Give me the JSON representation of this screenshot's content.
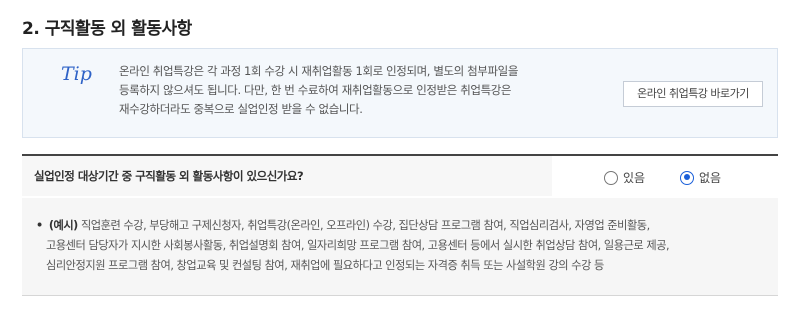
{
  "section": {
    "title": "2. 구직활동 외 활동사항"
  },
  "tip": {
    "icon_label": "Tip",
    "lines": [
      "온라인 취업특강은 각 과정 1회 수강 시 재취업활동 1회로 인정되며, 별도의 첨부파일을",
      "등록하지 않으셔도 됩니다. 다만, 한 번 수료하여 재취업활동으로 인정받은 취업특강은",
      "재수강하더라도 중복으로 실업인정 받을 수 없습니다."
    ],
    "button_label": "온라인 취업특강 바로가기"
  },
  "question": {
    "text": "실업인정 대상기간 중 구직활동 외 활동사항이 있으신가요?",
    "options": [
      {
        "label": "있음",
        "checked": false
      },
      {
        "label": "없음",
        "checked": true
      }
    ],
    "accent_color": "#1a5fd9"
  },
  "example": {
    "bullet": "•",
    "label": "(예시)",
    "line1": "직업훈련 수강, 부당해고 구제신청자, 취업특강(온라인, 오프라인) 수강, 집단상담 프로그램 참여, 직업심리검사, 자영업 준비활동,",
    "line2": "고용센터 담당자가 지시한 사회봉사활동, 취업설명회 참여, 일자리희망 프로그램 참여, 고용센터 등에서 실시한 취업상담 참여, 일용근로 제공,",
    "line3": "심리안정지원 프로그램 참여, 창업교육 및 컨설팅 참여, 재취업에 필요하다고 인정되는 자격증 취득 또는 사설학원 강의 수강 등"
  }
}
